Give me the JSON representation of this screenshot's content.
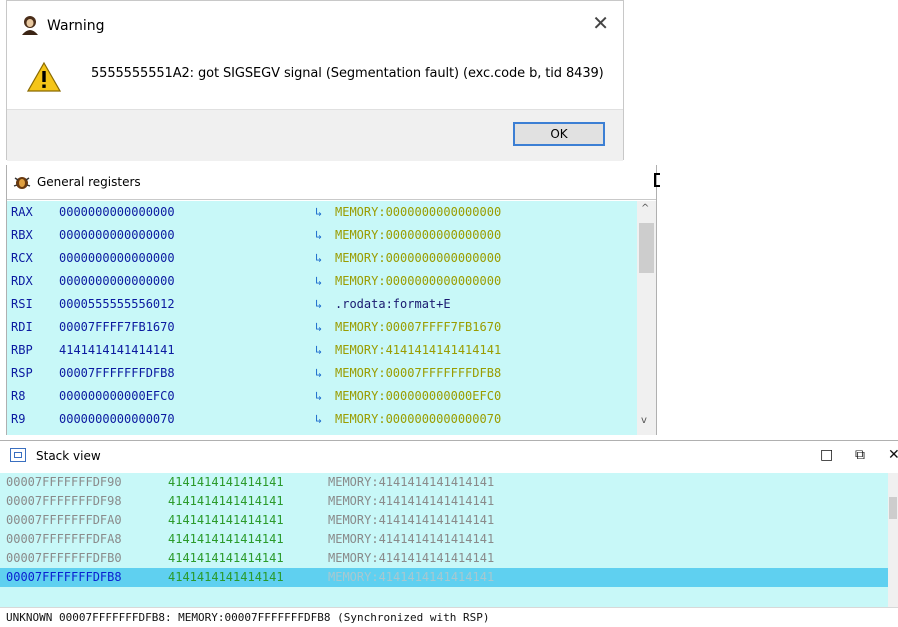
{
  "dialog": {
    "title": "Warning",
    "title_icon": "app-icon",
    "warning_icon": "warning-triangle-icon",
    "message": "5555555551A2: got SIGSEGV signal (Segmentation fault) (exc.code b, tid 8439)",
    "close_label": "✕",
    "ok_label": "OK"
  },
  "registers": {
    "title": "General registers",
    "icon": "bug-icon",
    "rows": [
      {
        "name": "RAX",
        "value": "0000000000000000",
        "arrow": "↳",
        "ref": "MEMORY:0000000000000000"
      },
      {
        "name": "RBX",
        "value": "0000000000000000",
        "arrow": "↳",
        "ref": "MEMORY:0000000000000000"
      },
      {
        "name": "RCX",
        "value": "0000000000000000",
        "arrow": "↳",
        "ref": "MEMORY:0000000000000000"
      },
      {
        "name": "RDX",
        "value": "0000000000000000",
        "arrow": "↳",
        "ref": "MEMORY:0000000000000000"
      },
      {
        "name": "RSI",
        "value": "0000555555556012",
        "arrow": "↳",
        "ref": ".rodata:format+E"
      },
      {
        "name": "RDI",
        "value": "00007FFFF7FB1670",
        "arrow": "↳",
        "ref": "MEMORY:00007FFFF7FB1670"
      },
      {
        "name": "RBP",
        "value": "4141414141414141",
        "arrow": "↳",
        "ref": "MEMORY:4141414141414141"
      },
      {
        "name": "RSP",
        "value": "00007FFFFFFFDFB8",
        "arrow": "↳",
        "ref": "MEMORY:00007FFFFFFFDFB8"
      },
      {
        "name": "R8",
        "value": "000000000000EFC0",
        "arrow": "↳",
        "ref": "MEMORY:000000000000EFC0"
      },
      {
        "name": "R9",
        "value": "0000000000000070",
        "arrow": "↳",
        "ref": "MEMORY:0000000000000070"
      }
    ],
    "scroll_up": "^",
    "scroll_down": "v"
  },
  "stack": {
    "title": "Stack view",
    "icon": "stack-view-icon",
    "controls": {
      "restore": "□",
      "float": "⧉",
      "close": "✕"
    },
    "rows": [
      {
        "addr": "00007FFFFFFFDF90",
        "value": "4141414141414141",
        "ref": "MEMORY:4141414141414141",
        "selected": false
      },
      {
        "addr": "00007FFFFFFFDF98",
        "value": "4141414141414141",
        "ref": "MEMORY:4141414141414141",
        "selected": false
      },
      {
        "addr": "00007FFFFFFFDFA0",
        "value": "4141414141414141",
        "ref": "MEMORY:4141414141414141",
        "selected": false
      },
      {
        "addr": "00007FFFFFFFDFA8",
        "value": "4141414141414141",
        "ref": "MEMORY:4141414141414141",
        "selected": false
      },
      {
        "addr": "00007FFFFFFFDFB0",
        "value": "4141414141414141",
        "ref": "MEMORY:4141414141414141",
        "selected": false
      },
      {
        "addr": "00007FFFFFFFDFB8",
        "value": "4141414141414141",
        "ref": "MEMORY:4141414141414141",
        "selected": true
      }
    ],
    "status": "UNKNOWN 00007FFFFFFFDFB8: MEMORY:00007FFFFFFFDFB8 (Synchronized with RSP)"
  }
}
